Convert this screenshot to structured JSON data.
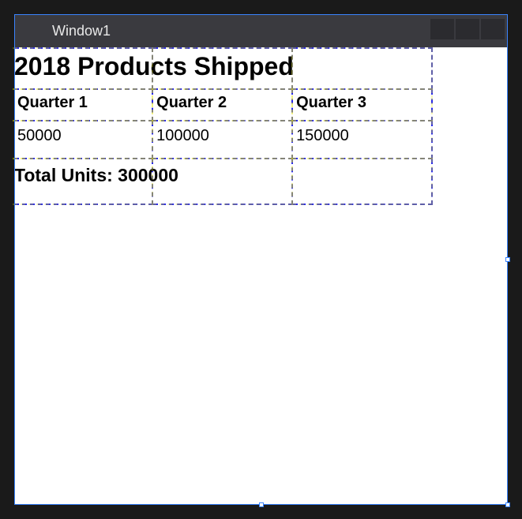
{
  "window": {
    "title": "Window1"
  },
  "content": {
    "title": "2018 Products Shipped",
    "columns": [
      "Quarter 1",
      "Quarter 2",
      "Quarter 3"
    ],
    "values": [
      "50000",
      "100000",
      "150000"
    ],
    "footer": "Total Units: 300000"
  },
  "chart_data": {
    "type": "table",
    "title": "2018 Products Shipped",
    "categories": [
      "Quarter 1",
      "Quarter 2",
      "Quarter 3"
    ],
    "values": [
      50000,
      100000,
      150000
    ],
    "total_label": "Total Units",
    "total_value": 300000
  }
}
